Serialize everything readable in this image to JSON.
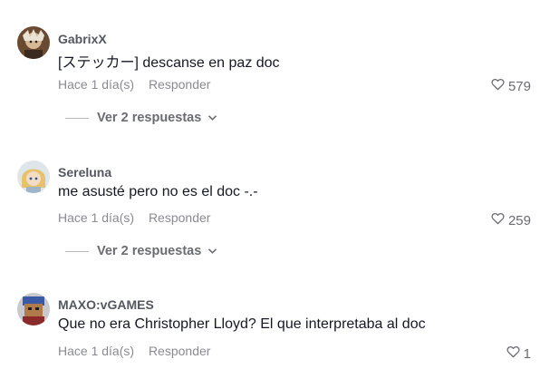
{
  "comments": [
    {
      "username": "GabrixX",
      "text": "[ステッカー] descanse en paz doc",
      "time": "Hace 1 día(s)",
      "reply_label": "Responder",
      "likes": "579",
      "replies_label": "Ver 2 respuestas"
    },
    {
      "username": "Sereluna",
      "text": "me asusté pero no es el doc -.-",
      "time": "Hace 1 día(s)",
      "reply_label": "Responder",
      "likes": "259",
      "replies_label": "Ver 2 respuestas"
    },
    {
      "username": "MAXO:vGAMES",
      "text": "Que no era Christopher Lloyd? El que interpretaba al doc",
      "time": "Hace 1 día(s)",
      "reply_label": "Responder",
      "likes": "1"
    }
  ],
  "icons": {
    "like": "heart-outline-icon",
    "expand": "chevron-down-icon"
  },
  "colors": {
    "username": "#555760",
    "text": "#161823",
    "meta": "#8a8b91"
  }
}
